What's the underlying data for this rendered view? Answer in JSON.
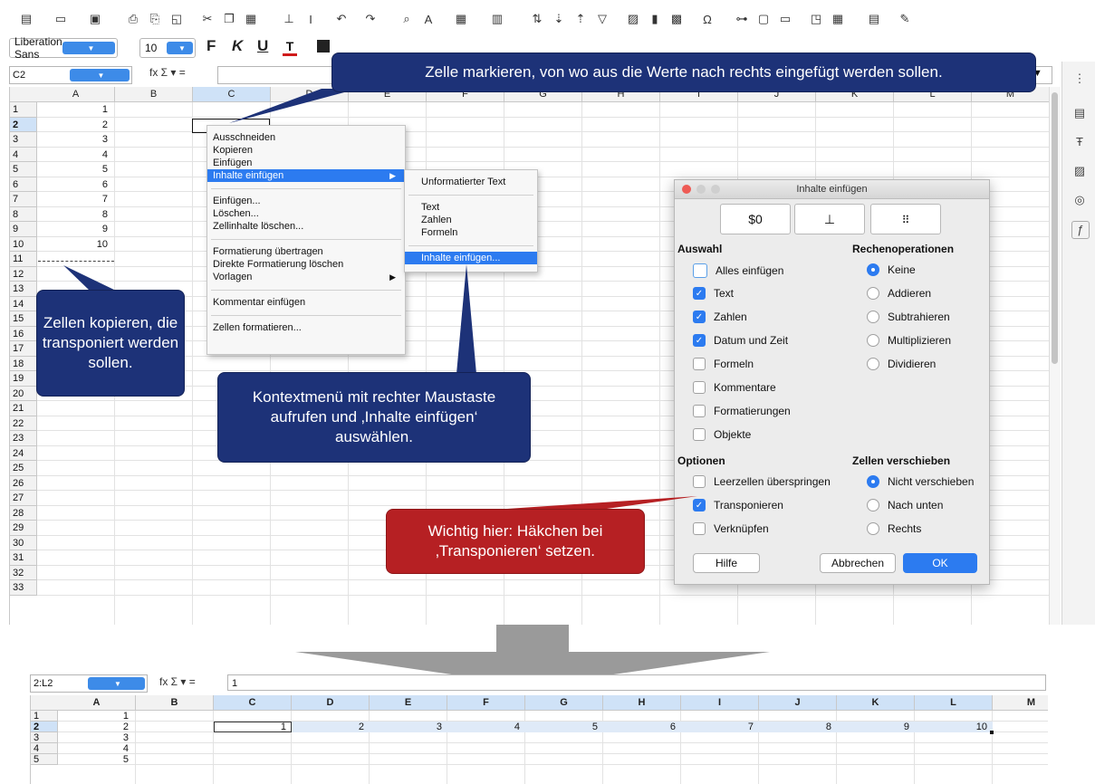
{
  "toolbar": {
    "font_name": "Liberation Sans",
    "font_size": "10",
    "bold": "F",
    "italic": "K",
    "underline": "U"
  },
  "top_sheet": {
    "name_box": "C2",
    "fx_icons": "fx Σ ▾ =",
    "columns": [
      "A",
      "B",
      "C",
      "D",
      "E",
      "F",
      "G",
      "H",
      "I",
      "J",
      "K",
      "L",
      "M"
    ],
    "selected_column": "C",
    "selected_row": "2",
    "rows": [
      "1",
      "2",
      "3",
      "4",
      "5",
      "6",
      "7",
      "8",
      "9",
      "10",
      "11",
      "12",
      "13",
      "14",
      "15",
      "16",
      "17",
      "18",
      "19",
      "20",
      "21",
      "22",
      "23",
      "24",
      "25",
      "26",
      "27",
      "28",
      "29",
      "30",
      "31",
      "32",
      "33"
    ],
    "column_a_values": [
      "1",
      "2",
      "3",
      "4",
      "5",
      "6",
      "7",
      "8",
      "9",
      "10"
    ]
  },
  "context_menu": {
    "items": [
      "Ausschneiden",
      "Kopieren",
      "Einfügen",
      "Inhalte einfügen",
      "Einfügen...",
      "Löschen...",
      "Zellinhalte löschen...",
      "Formatierung übertragen",
      "Direkte Formatierung löschen",
      "Vorlagen",
      "Kommentar einfügen",
      "Zellen formatieren..."
    ],
    "submenu": [
      "Unformatierter Text",
      "Text",
      "Zahlen",
      "Formeln",
      "Inhalte einfügen..."
    ]
  },
  "dialog": {
    "title": "Inhalte einfügen",
    "preset_1": "$0",
    "section_selection": "Auswahl",
    "selection_items": [
      "Alles einfügen",
      "Text",
      "Zahlen",
      "Datum und Zeit",
      "Formeln",
      "Kommentare",
      "Formatierungen",
      "Objekte"
    ],
    "section_operations": "Rechenoperationen",
    "operations": [
      "Keine",
      "Addieren",
      "Subtrahieren",
      "Multiplizieren",
      "Dividieren"
    ],
    "section_options": "Optionen",
    "options": [
      "Leerzellen überspringen",
      "Transponieren",
      "Verknüpfen"
    ],
    "section_shift": "Zellen verschieben",
    "shift": [
      "Nicht verschieben",
      "Nach unten",
      "Rechts"
    ],
    "help": "Hilfe",
    "cancel": "Abbrechen",
    "ok": "OK"
  },
  "callouts": {
    "top": "Zelle markieren, von wo aus die Werte nach rechts eingefügt werden sollen.",
    "left": "Zellen kopieren, die transponiert werden sollen.",
    "middle": "Kontextmenü mit rechter Maustaste aufrufen und ‚Inhalte einfügen‘ auswählen.",
    "red": "Wichtig hier: Häkchen bei ‚Transponieren‘ setzen."
  },
  "bottom_sheet": {
    "name_box": "2:L2",
    "fx_icons": "fx Σ ▾ =",
    "formula_value": "1",
    "columns": [
      "A",
      "B",
      "C",
      "D",
      "E",
      "F",
      "G",
      "H",
      "I",
      "J",
      "K",
      "L",
      "M"
    ],
    "rows": [
      "1",
      "2",
      "3",
      "4",
      "5"
    ],
    "column_a_values": [
      "1",
      "2",
      "3",
      "4",
      "5"
    ],
    "row2_values": [
      "1",
      "2",
      "3",
      "4",
      "5",
      "6",
      "7",
      "8",
      "9",
      "10"
    ]
  },
  "colors": {
    "callout_navy": "#1d3278",
    "callout_red": "#b62023",
    "accent": "#2c7bf0",
    "selection": "#cfe2f7",
    "arrow_gray": "#9a9a9a"
  }
}
